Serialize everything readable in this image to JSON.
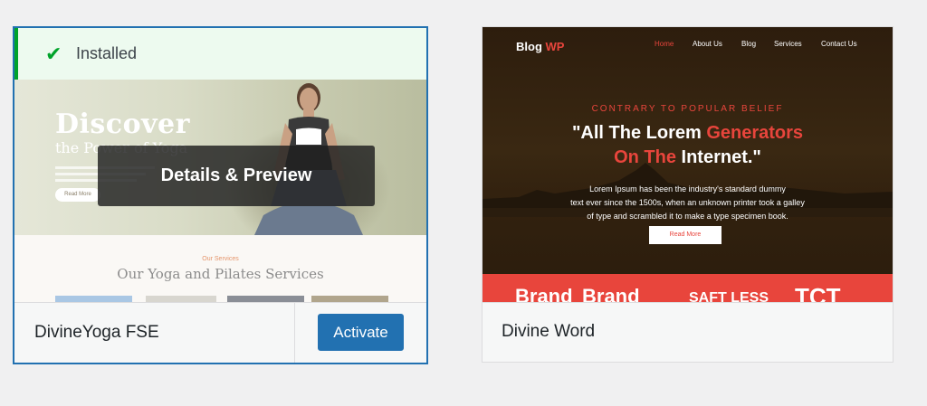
{
  "themes": [
    {
      "installed_label": "Installed",
      "screenshot": {
        "hero_title": "Discover",
        "hero_subtitle": "the Power of Yoga",
        "hero_button": "Read More",
        "services_label": "Our Services",
        "services_title": "Our Yoga and Pilates Services"
      },
      "overlay_label": "Details & Preview",
      "name": "DivineYoga FSE",
      "activate_label": "Activate"
    },
    {
      "screenshot": {
        "logo_main": "Blog",
        "logo_accent": "WP",
        "nav": [
          "Home",
          "About Us",
          "Blog",
          "Services",
          "Contact Us"
        ],
        "eyebrow": "CONTRARY TO POPULAR BELIEF",
        "headline_a": "\"All The Lorem ",
        "headline_b": "Generators",
        "headline_c": "On The",
        "headline_d": " Internet.\"",
        "paragraph_1": "Lorem Ipsum has been the industry's standard dummy",
        "paragraph_2": "text ever since the 1500s, when an unknown printer took a galley",
        "paragraph_3": "of type and scrambled it to make a type specimen book.",
        "read_more": "Read More",
        "brand_1": "Brand",
        "brand_2": "Brand",
        "brand_3": "SAFT LESS",
        "brand_4": "TCT"
      },
      "name": "Divine Word"
    }
  ],
  "colors": {
    "accent_blue": "#2271b1",
    "installed_green": "#00a32a",
    "blog_red": "#e8453c"
  },
  "icons": {
    "installed": "checkmark-icon"
  }
}
